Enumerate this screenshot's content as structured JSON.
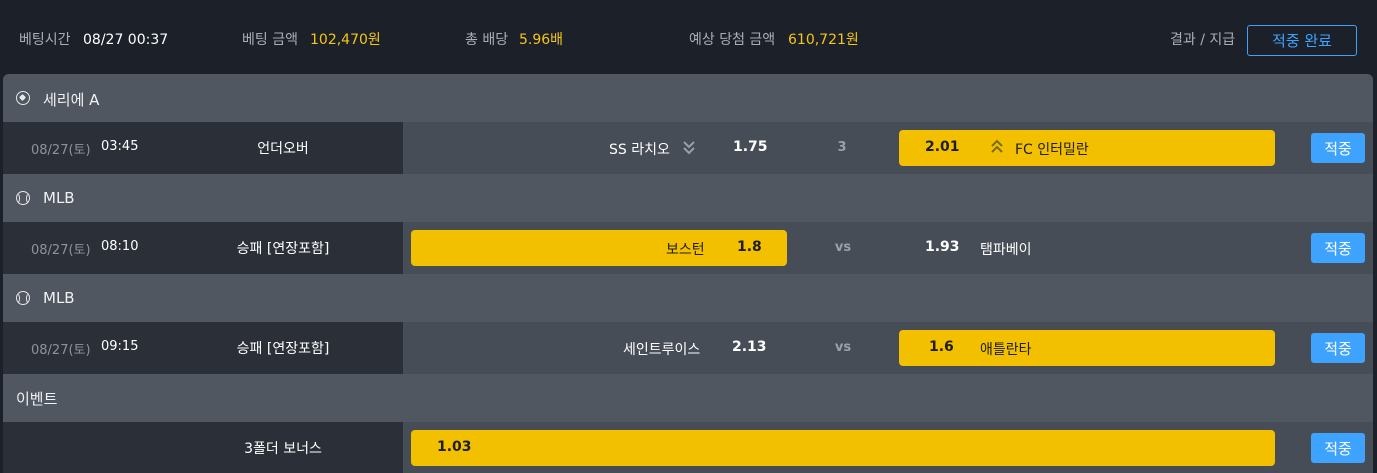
{
  "header": {
    "bet_time_label": "베팅시간",
    "bet_time_value": "08/27 00:37",
    "bet_amount_label": "베팅 금액",
    "bet_amount_value": "102,470원",
    "total_odds_label": "총 배당",
    "total_odds_value": "5.96배",
    "expected_win_label": "예상 당첨 금액",
    "expected_win_value": "610,721원",
    "result_label": "결과 / 지급",
    "done_button": "적중 완료"
  },
  "colors": {
    "accent": "#3ea3ff",
    "selected": "#f3c000",
    "highlight_text": "#f5c518"
  },
  "sections": [
    {
      "title": "세리에 A",
      "icon": "soccer-ball-icon",
      "row": {
        "date": "08/27(토)",
        "time": "03:45",
        "market": "언더오버",
        "home_team": "SS 라치오",
        "home_icon": "double-chevron-down-icon",
        "home_odds": "1.75",
        "middle": "3",
        "away_odds": "2.01",
        "away_icon": "double-chevron-up-icon",
        "away_team": "FC 인터밀란",
        "selected": "away",
        "result_button": "적중"
      }
    },
    {
      "title": "MLB",
      "icon": "baseball-icon",
      "row": {
        "date": "08/27(토)",
        "time": "08:10",
        "market": "승패 [연장포함]",
        "home_team": "보스턴",
        "home_odds": "1.8",
        "middle": "vs",
        "away_odds": "1.93",
        "away_team": "탬파베이",
        "selected": "home",
        "result_button": "적중"
      }
    },
    {
      "title": "MLB",
      "icon": "baseball-icon",
      "row": {
        "date": "08/27(토)",
        "time": "09:15",
        "market": "승패 [연장포함]",
        "home_team": "세인트루이스",
        "home_odds": "2.13",
        "middle": "vs",
        "away_odds": "1.6",
        "away_team": "애틀란타",
        "selected": "away",
        "result_button": "적중"
      }
    },
    {
      "title": "이벤트",
      "row": {
        "market": "3폴더 보너스",
        "odds": "1.03",
        "result_button": "적중"
      }
    }
  ]
}
